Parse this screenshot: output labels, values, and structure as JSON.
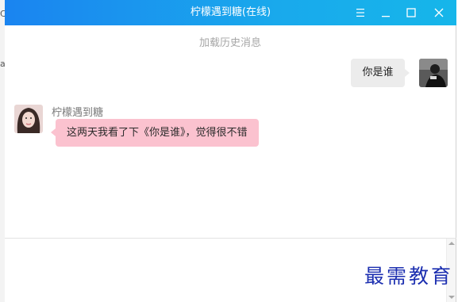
{
  "background_app": {
    "fragments": [
      "C",
      "a"
    ]
  },
  "window": {
    "title": "柠檬遇到糖(在线)",
    "controls": [
      "menu-icon",
      "minimize-icon",
      "maximize-icon",
      "close-icon"
    ]
  },
  "chat": {
    "load_history": "加载历史消息",
    "messages": [
      {
        "sender": "me",
        "text": "你是谁"
      },
      {
        "sender": "柠檬遇到糖",
        "text": "这两天我看了下《你是谁》，觉得很不错"
      }
    ]
  },
  "input": {
    "value": ""
  },
  "watermark": "最需教育",
  "colors": {
    "titlebar_start": "#1a84f0",
    "titlebar_end": "#16b6ea",
    "my_bubble": "#ececec",
    "their_bubble": "#fbc2cf",
    "history_link": "#a6a6a6",
    "watermark": "#1c2fb0"
  }
}
